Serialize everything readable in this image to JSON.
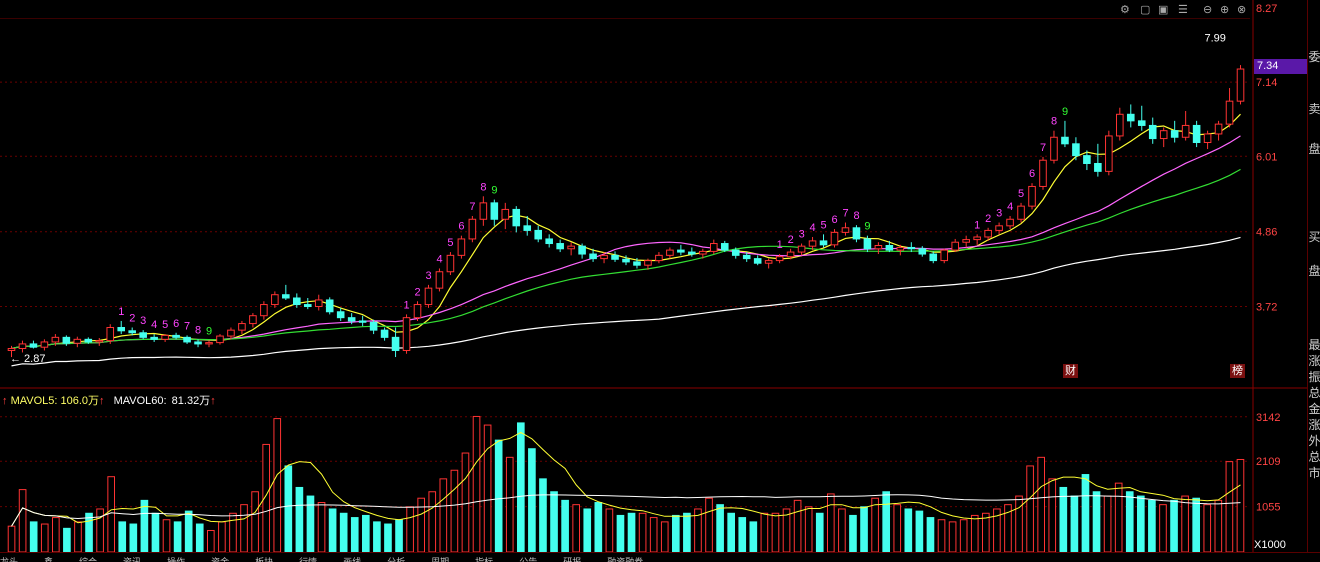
{
  "chart_data": [
    {
      "type": "candlestick",
      "title": "",
      "y_axis_ticks": [
        "8.27",
        "7.14",
        "6.01",
        "4.86",
        "3.72"
      ],
      "ylim": [
        2.6,
        8.27
      ],
      "current_price_label": "7.34",
      "high_label": "7.99",
      "low_label": "2.87",
      "ohlc": [
        [
          3.05,
          3.12,
          2.95,
          3.08
        ],
        [
          3.08,
          3.2,
          3.02,
          3.15
        ],
        [
          3.15,
          3.2,
          3.08,
          3.1
        ],
        [
          3.1,
          3.22,
          3.05,
          3.18
        ],
        [
          3.18,
          3.3,
          3.12,
          3.25
        ],
        [
          3.25,
          3.28,
          3.12,
          3.16
        ],
        [
          3.16,
          3.26,
          3.1,
          3.22
        ],
        [
          3.22,
          3.25,
          3.15,
          3.18
        ],
        [
          3.18,
          3.24,
          3.12,
          3.2
        ],
        [
          3.2,
          3.45,
          3.15,
          3.4
        ],
        [
          3.4,
          3.5,
          3.3,
          3.35
        ],
        [
          3.35,
          3.4,
          3.28,
          3.32
        ],
        [
          3.32,
          3.36,
          3.22,
          3.25
        ],
        [
          3.25,
          3.3,
          3.18,
          3.22
        ],
        [
          3.22,
          3.3,
          3.18,
          3.28
        ],
        [
          3.28,
          3.32,
          3.22,
          3.25
        ],
        [
          3.25,
          3.28,
          3.15,
          3.18
        ],
        [
          3.18,
          3.22,
          3.1,
          3.15
        ],
        [
          3.15,
          3.2,
          3.1,
          3.17
        ],
        [
          3.17,
          3.3,
          3.14,
          3.27
        ],
        [
          3.27,
          3.4,
          3.22,
          3.36
        ],
        [
          3.36,
          3.5,
          3.3,
          3.46
        ],
        [
          3.46,
          3.62,
          3.4,
          3.58
        ],
        [
          3.58,
          3.8,
          3.52,
          3.75
        ],
        [
          3.75,
          3.95,
          3.7,
          3.9
        ],
        [
          3.9,
          4.05,
          3.82,
          3.85
        ],
        [
          3.85,
          3.92,
          3.7,
          3.75
        ],
        [
          3.75,
          3.85,
          3.68,
          3.72
        ],
        [
          3.72,
          3.9,
          3.66,
          3.82
        ],
        [
          3.82,
          3.86,
          3.6,
          3.64
        ],
        [
          3.64,
          3.7,
          3.5,
          3.55
        ],
        [
          3.55,
          3.62,
          3.45,
          3.5
        ],
        [
          3.5,
          3.58,
          3.42,
          3.48
        ],
        [
          3.48,
          3.52,
          3.3,
          3.36
        ],
        [
          3.36,
          3.4,
          3.2,
          3.25
        ],
        [
          3.25,
          3.4,
          2.95,
          3.05
        ],
        [
          3.05,
          3.6,
          3.0,
          3.55
        ],
        [
          3.55,
          3.8,
          3.5,
          3.75
        ],
        [
          3.75,
          4.05,
          3.7,
          4.0
        ],
        [
          4.0,
          4.3,
          3.95,
          4.25
        ],
        [
          4.25,
          4.55,
          4.2,
          4.5
        ],
        [
          4.5,
          4.8,
          4.45,
          4.75
        ],
        [
          4.75,
          5.1,
          4.7,
          5.05
        ],
        [
          5.05,
          5.4,
          4.95,
          5.3
        ],
        [
          5.3,
          5.35,
          4.95,
          5.05
        ],
        [
          5.05,
          5.3,
          4.9,
          5.2
        ],
        [
          5.2,
          5.25,
          4.85,
          4.95
        ],
        [
          4.95,
          5.1,
          4.8,
          4.88
        ],
        [
          4.88,
          4.95,
          4.7,
          4.75
        ],
        [
          4.75,
          4.82,
          4.62,
          4.68
        ],
        [
          4.68,
          4.74,
          4.55,
          4.6
        ],
        [
          4.6,
          4.7,
          4.5,
          4.64
        ],
        [
          4.64,
          4.68,
          4.45,
          4.52
        ],
        [
          4.52,
          4.6,
          4.4,
          4.45
        ],
        [
          4.45,
          4.55,
          4.38,
          4.5
        ],
        [
          4.5,
          4.56,
          4.4,
          4.44
        ],
        [
          4.44,
          4.5,
          4.35,
          4.4
        ],
        [
          4.4,
          4.46,
          4.3,
          4.35
        ],
        [
          4.35,
          4.45,
          4.28,
          4.42
        ],
        [
          4.42,
          4.55,
          4.38,
          4.5
        ],
        [
          4.5,
          4.62,
          4.45,
          4.58
        ],
        [
          4.58,
          4.66,
          4.5,
          4.55
        ],
        [
          4.55,
          4.62,
          4.48,
          4.52
        ],
        [
          4.52,
          4.6,
          4.45,
          4.56
        ],
        [
          4.56,
          4.74,
          4.52,
          4.68
        ],
        [
          4.68,
          4.72,
          4.55,
          4.58
        ],
        [
          4.58,
          4.62,
          4.45,
          4.5
        ],
        [
          4.5,
          4.55,
          4.4,
          4.45
        ],
        [
          4.45,
          4.5,
          4.35,
          4.38
        ],
        [
          4.38,
          4.45,
          4.3,
          4.42
        ],
        [
          4.42,
          4.52,
          4.38,
          4.48
        ],
        [
          4.48,
          4.6,
          4.44,
          4.55
        ],
        [
          4.55,
          4.68,
          4.5,
          4.64
        ],
        [
          4.64,
          4.78,
          4.58,
          4.72
        ],
        [
          4.72,
          4.82,
          4.62,
          4.66
        ],
        [
          4.66,
          4.9,
          4.62,
          4.85
        ],
        [
          4.85,
          5.0,
          4.8,
          4.92
        ],
        [
          4.92,
          4.96,
          4.7,
          4.75
        ],
        [
          4.75,
          4.8,
          4.55,
          4.6
        ],
        [
          4.6,
          4.7,
          4.52,
          4.65
        ],
        [
          4.65,
          4.72,
          4.55,
          4.58
        ],
        [
          4.58,
          4.66,
          4.5,
          4.62
        ],
        [
          4.62,
          4.7,
          4.55,
          4.6
        ],
        [
          4.6,
          4.64,
          4.48,
          4.52
        ],
        [
          4.52,
          4.56,
          4.38,
          4.42
        ],
        [
          4.42,
          4.6,
          4.38,
          4.58
        ],
        [
          4.58,
          4.75,
          4.55,
          4.7
        ],
        [
          4.7,
          4.8,
          4.62,
          4.74
        ],
        [
          4.74,
          4.82,
          4.66,
          4.78
        ],
        [
          4.78,
          4.92,
          4.72,
          4.88
        ],
        [
          4.88,
          5.0,
          4.82,
          4.95
        ],
        [
          4.95,
          5.1,
          4.9,
          5.05
        ],
        [
          5.05,
          5.3,
          5.0,
          5.25
        ],
        [
          5.25,
          5.6,
          5.2,
          5.55
        ],
        [
          5.55,
          6.0,
          5.5,
          5.95
        ],
        [
          5.95,
          6.4,
          5.9,
          6.3
        ],
        [
          6.3,
          6.55,
          6.15,
          6.2
        ],
        [
          6.2,
          6.3,
          5.95,
          6.02
        ],
        [
          6.02,
          6.1,
          5.8,
          5.9
        ],
        [
          5.9,
          6.2,
          5.7,
          5.78
        ],
        [
          5.78,
          6.4,
          5.72,
          6.32
        ],
        [
          6.32,
          6.75,
          6.25,
          6.65
        ],
        [
          6.65,
          6.8,
          6.45,
          6.55
        ],
        [
          6.55,
          6.78,
          6.4,
          6.48
        ],
        [
          6.48,
          6.6,
          6.2,
          6.28
        ],
        [
          6.28,
          6.45,
          6.15,
          6.4
        ],
        [
          6.4,
          6.55,
          6.22,
          6.3
        ],
        [
          6.3,
          6.7,
          6.25,
          6.48
        ],
        [
          6.48,
          6.55,
          6.15,
          6.22
        ],
        [
          6.22,
          6.4,
          6.12,
          6.35
        ],
        [
          6.35,
          6.55,
          6.25,
          6.5
        ],
        [
          6.5,
          7.05,
          6.45,
          6.85
        ],
        [
          6.85,
          7.4,
          6.8,
          7.34
        ]
      ],
      "ma_series": [
        {
          "color": "#ffffff"
        },
        {
          "color": "#ffff33"
        },
        {
          "color": "#ff66ff"
        },
        {
          "color": "#33dd33"
        }
      ],
      "markers": [
        {
          "label": "1",
          "i": 10,
          "color": "#ff44ff"
        },
        {
          "label": "2",
          "i": 11,
          "color": "#ff44ff"
        },
        {
          "label": "3",
          "i": 12,
          "color": "#ff44ff"
        },
        {
          "label": "4",
          "i": 13,
          "color": "#ff44ff"
        },
        {
          "label": "5",
          "i": 14,
          "color": "#ff44ff"
        },
        {
          "label": "6",
          "i": 15,
          "color": "#ff44ff"
        },
        {
          "label": "7",
          "i": 16,
          "color": "#ff44ff"
        },
        {
          "label": "8",
          "i": 17,
          "color": "#ff44ff"
        },
        {
          "label": "9",
          "i": 18,
          "color": "#33ff33"
        },
        {
          "label": "1",
          "i": 36,
          "color": "#ff44ff"
        },
        {
          "label": "2",
          "i": 37,
          "color": "#ff44ff"
        },
        {
          "label": "3",
          "i": 38,
          "color": "#ff44ff"
        },
        {
          "label": "4",
          "i": 39,
          "color": "#ff44ff"
        },
        {
          "label": "5",
          "i": 40,
          "color": "#ff44ff"
        },
        {
          "label": "6",
          "i": 41,
          "color": "#ff44ff"
        },
        {
          "label": "7",
          "i": 42,
          "color": "#ff44ff"
        },
        {
          "label": "8",
          "i": 43,
          "color": "#ff44ff"
        },
        {
          "label": "9",
          "i": 44,
          "color": "#33ff33"
        },
        {
          "label": "1",
          "i": 70,
          "color": "#ff44ff"
        },
        {
          "label": "2",
          "i": 71,
          "color": "#ff44ff"
        },
        {
          "label": "3",
          "i": 72,
          "color": "#ff44ff"
        },
        {
          "label": "4",
          "i": 73,
          "color": "#ff44ff"
        },
        {
          "label": "5",
          "i": 74,
          "color": "#ff44ff"
        },
        {
          "label": "6",
          "i": 75,
          "color": "#ff44ff"
        },
        {
          "label": "7",
          "i": 76,
          "color": "#ff44ff"
        },
        {
          "label": "8",
          "i": 77,
          "color": "#ff44ff"
        },
        {
          "label": "9",
          "i": 78,
          "color": "#33ff33"
        },
        {
          "label": "1",
          "i": 88,
          "color": "#ff44ff"
        },
        {
          "label": "2",
          "i": 89,
          "color": "#ff44ff"
        },
        {
          "label": "3",
          "i": 90,
          "color": "#ff44ff"
        },
        {
          "label": "4",
          "i": 91,
          "color": "#ff44ff"
        },
        {
          "label": "5",
          "i": 92,
          "color": "#ff44ff"
        },
        {
          "label": "6",
          "i": 93,
          "color": "#ff44ff"
        },
        {
          "label": "7",
          "i": 94,
          "color": "#ff44ff"
        },
        {
          "label": "8",
          "i": 95,
          "color": "#ff44ff"
        },
        {
          "label": "9",
          "i": 96,
          "color": "#33ff33"
        }
      ]
    },
    {
      "type": "bar",
      "title": "",
      "y_axis_ticks": [
        "3142",
        "2109",
        "1055"
      ],
      "unit_label": "X1000",
      "ylim": [
        0,
        3300
      ],
      "mavol5_label": "MAVOL5:",
      "mavol5_value": "106.0万",
      "mavol60_label": "MAVOL60:",
      "mavol60_value": "81.32万",
      "values": [
        600,
        1450,
        700,
        650,
        800,
        550,
        700,
        900,
        1000,
        1750,
        700,
        650,
        1200,
        900,
        750,
        700,
        950,
        650,
        500,
        700,
        900,
        1100,
        1400,
        2500,
        3100,
        2000,
        1500,
        1300,
        1150,
        1000,
        900,
        800,
        850,
        700,
        650,
        750,
        1050,
        1250,
        1400,
        1700,
        1900,
        2300,
        3150,
        2950,
        2600,
        2200,
        3000,
        2400,
        1700,
        1400,
        1200,
        1100,
        1000,
        1150,
        1000,
        850,
        900,
        900,
        800,
        700,
        850,
        900,
        1000,
        1250,
        1100,
        900,
        800,
        700,
        900,
        900,
        1000,
        1200,
        1050,
        900,
        1350,
        1000,
        850,
        1050,
        1250,
        1400,
        1100,
        1000,
        950,
        800,
        750,
        700,
        750,
        850,
        900,
        1000,
        1100,
        1300,
        2000,
        2200,
        1700,
        1500,
        1300,
        1800,
        1400,
        1300,
        1600,
        1400,
        1300,
        1200,
        1100,
        1200,
        1300,
        1250,
        1100,
        1200,
        2100,
        2150
      ],
      "ma_series": [
        {
          "color": "#ffff33"
        },
        {
          "color": "#ffffff"
        }
      ]
    }
  ],
  "side_panel": {
    "labels": [
      "委",
      "卖",
      "盘",
      "买",
      "盘",
      "最",
      "涨",
      "振",
      "总",
      "金",
      "涨",
      "外",
      "总",
      "市"
    ]
  },
  "tags": {
    "finance_tag": "财",
    "rank_tag": "榜"
  },
  "bottom_bar": {
    "items": [
      "龙头",
      "鑫",
      "综合",
      "资讯",
      "操作",
      "资金",
      "板块",
      "行情",
      "画线",
      "分析",
      "周期",
      "指标",
      "公告",
      "研报",
      "融资融券"
    ]
  },
  "colors": {
    "up": "#ff3333",
    "down": "#44ffee",
    "grid": "#6a0000"
  }
}
